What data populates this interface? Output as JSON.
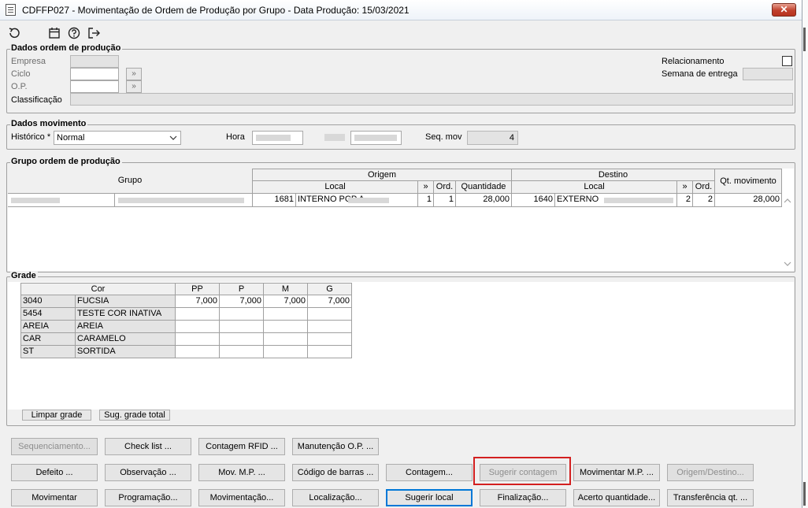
{
  "window": {
    "title": "CDFFP027 - Movimentação de Ordem de Produção por Grupo - Data Produção: 15/03/2021",
    "close": "✕"
  },
  "toolbar": {
    "icons": [
      "refresh-icon",
      "calendar-icon",
      "help-icon",
      "exit-icon"
    ]
  },
  "dados_ordem": {
    "title": "Dados ordem de produção",
    "empresa_label": "Empresa",
    "ciclo_label": "Ciclo",
    "op_label": "O.P.",
    "classificacao_label": "Classificação",
    "relacionamento_label": "Relacionamento",
    "semana_label": "Semana de entrega",
    "lookup_glyph": "»"
  },
  "dados_movimento": {
    "title": "Dados movimento",
    "historico_label": "Histórico *",
    "historico_value": "Normal",
    "hora_label": "Hora",
    "seq_label": "Seq. mov",
    "seq_value": "4"
  },
  "grupo_ordem": {
    "title": "Grupo ordem de produção",
    "headers": {
      "grupo": "Grupo",
      "origem": "Origem",
      "destino": "Destino",
      "qt": "Qt. movimento",
      "local": "Local",
      "seq": "»",
      "ord": "Ord.",
      "quantidade": "Quantidade"
    },
    "row": {
      "origem_code": "1681",
      "origem_local": "INTERNO PCP A",
      "origem_seq": "1",
      "origem_ord": "1",
      "quantidade": "28,000",
      "destino_code": "1640",
      "destino_local": "EXTERNO",
      "destino_seq": "2",
      "destino_ord": "2",
      "qt_movimento": "28,000"
    }
  },
  "grade": {
    "title": "Grade",
    "cor_header": "Cor",
    "sizes": [
      "PP",
      "P",
      "M",
      "G"
    ],
    "rows": [
      {
        "code": "3040",
        "name": "FUCSIA",
        "values": [
          "7,000",
          "7,000",
          "7,000",
          "7,000"
        ]
      },
      {
        "code": "5454",
        "name": "TESTE COR INATIVA",
        "values": [
          "",
          "",
          "",
          ""
        ]
      },
      {
        "code": "AREIA",
        "name": "AREIA",
        "values": [
          "",
          "",
          "",
          ""
        ]
      },
      {
        "code": "CAR",
        "name": "CARAMELO",
        "values": [
          "",
          "",
          "",
          ""
        ]
      },
      {
        "code": "ST",
        "name": "SORTIDA",
        "values": [
          "",
          "",
          "",
          ""
        ]
      }
    ],
    "limpar": "Limpar grade",
    "sugerir_total": "Sug. grade total"
  },
  "buttons": {
    "row1": [
      "Sequenciamento...",
      "Check list ...",
      "Contagem RFID ...",
      "Manutenção O.P. ..."
    ],
    "row2": [
      "Defeito ...",
      "Observação ...",
      "Mov. M.P. ...",
      "Código de barras ...",
      "Contagem...",
      "Sugerir contagem",
      "Movimentar M.P. ...",
      "Origem/Destino..."
    ],
    "row3": [
      "Movimentar",
      "Programação...",
      "Movimentação...",
      "Localização...",
      "Sugerir local",
      "Finalização...",
      "Acerto quantidade...",
      "Transferência qt. ..."
    ]
  }
}
